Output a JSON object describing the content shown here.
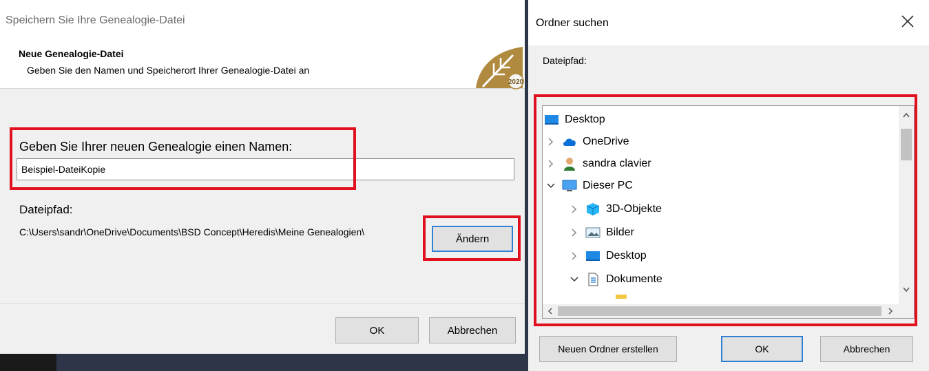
{
  "left_dialog": {
    "title": "Speichern Sie Ihre Genealogie-Datei",
    "header_title": "Neue Genealogie-Datei",
    "header_subtitle": "Geben Sie den Namen und Speicherort Ihrer Genealogie-Datei an",
    "logo_text": "2020",
    "name_label": "Geben Sie Ihrer neuen Genealogie einen Namen:",
    "name_value": "Beispiel-DateiKopie",
    "path_label": "Dateipfad:",
    "path_value": "C:\\Users\\sandr\\OneDrive\\Documents\\BSD Concept\\Heredis\\Meine Genealogien\\",
    "change_button": "Ändern",
    "ok_button": "OK",
    "cancel_button": "Abbrechen"
  },
  "right_dialog": {
    "title": "Ordner suchen",
    "path_label": "Dateipfad:",
    "tree": [
      {
        "label": "Desktop",
        "icon": "desktop-icon",
        "expander": "none"
      },
      {
        "label": "OneDrive",
        "icon": "cloud-icon",
        "expander": "collapsed"
      },
      {
        "label": "sandra clavier",
        "icon": "user-icon",
        "expander": "collapsed"
      },
      {
        "label": "Dieser PC",
        "icon": "computer-icon",
        "expander": "expanded"
      },
      {
        "label": "3D-Objekte",
        "icon": "cube-icon",
        "expander": "collapsed"
      },
      {
        "label": "Bilder",
        "icon": "pictures-icon",
        "expander": "collapsed"
      },
      {
        "label": "Desktop",
        "icon": "desktop-icon",
        "expander": "collapsed"
      },
      {
        "label": "Dokumente",
        "icon": "document-icon",
        "expander": "expanded"
      }
    ],
    "new_folder_button": "Neuen Ordner erstellen",
    "ok_button": "OK",
    "cancel_button": "Abbrechen"
  },
  "colors": {
    "highlight_red": "#e0101e",
    "focus_blue": "#2f7fd3"
  }
}
